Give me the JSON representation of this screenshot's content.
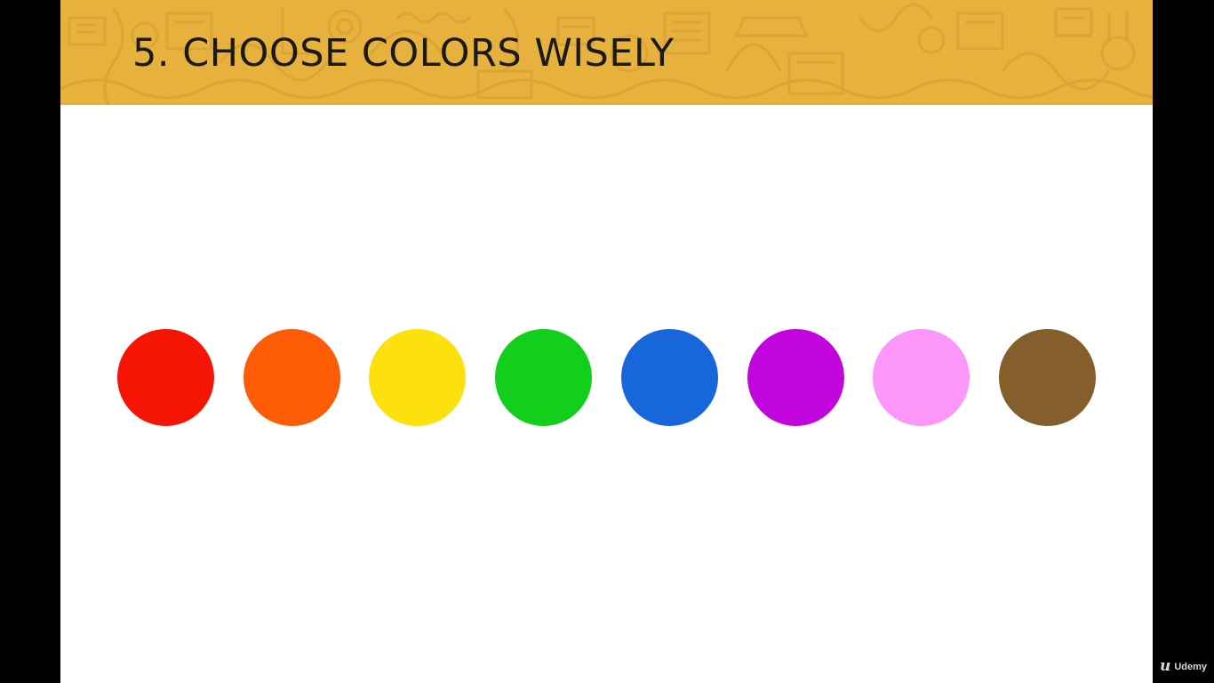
{
  "slide": {
    "title": "5. CHOOSE COLORS WISELY",
    "banner_color": "#e6b13c",
    "background_color": "#ffffff"
  },
  "swatches": [
    {
      "name": "red",
      "color": "#f51505"
    },
    {
      "name": "orange",
      "color": "#fc5c05"
    },
    {
      "name": "yellow",
      "color": "#fce10f"
    },
    {
      "name": "green",
      "color": "#12cf1c"
    },
    {
      "name": "blue",
      "color": "#1866dc"
    },
    {
      "name": "purple",
      "color": "#c205dc"
    },
    {
      "name": "pink",
      "color": "#fc97f9"
    },
    {
      "name": "brown",
      "color": "#855f2b"
    }
  ],
  "watermark": {
    "logo": "u",
    "label": "Udemy"
  }
}
